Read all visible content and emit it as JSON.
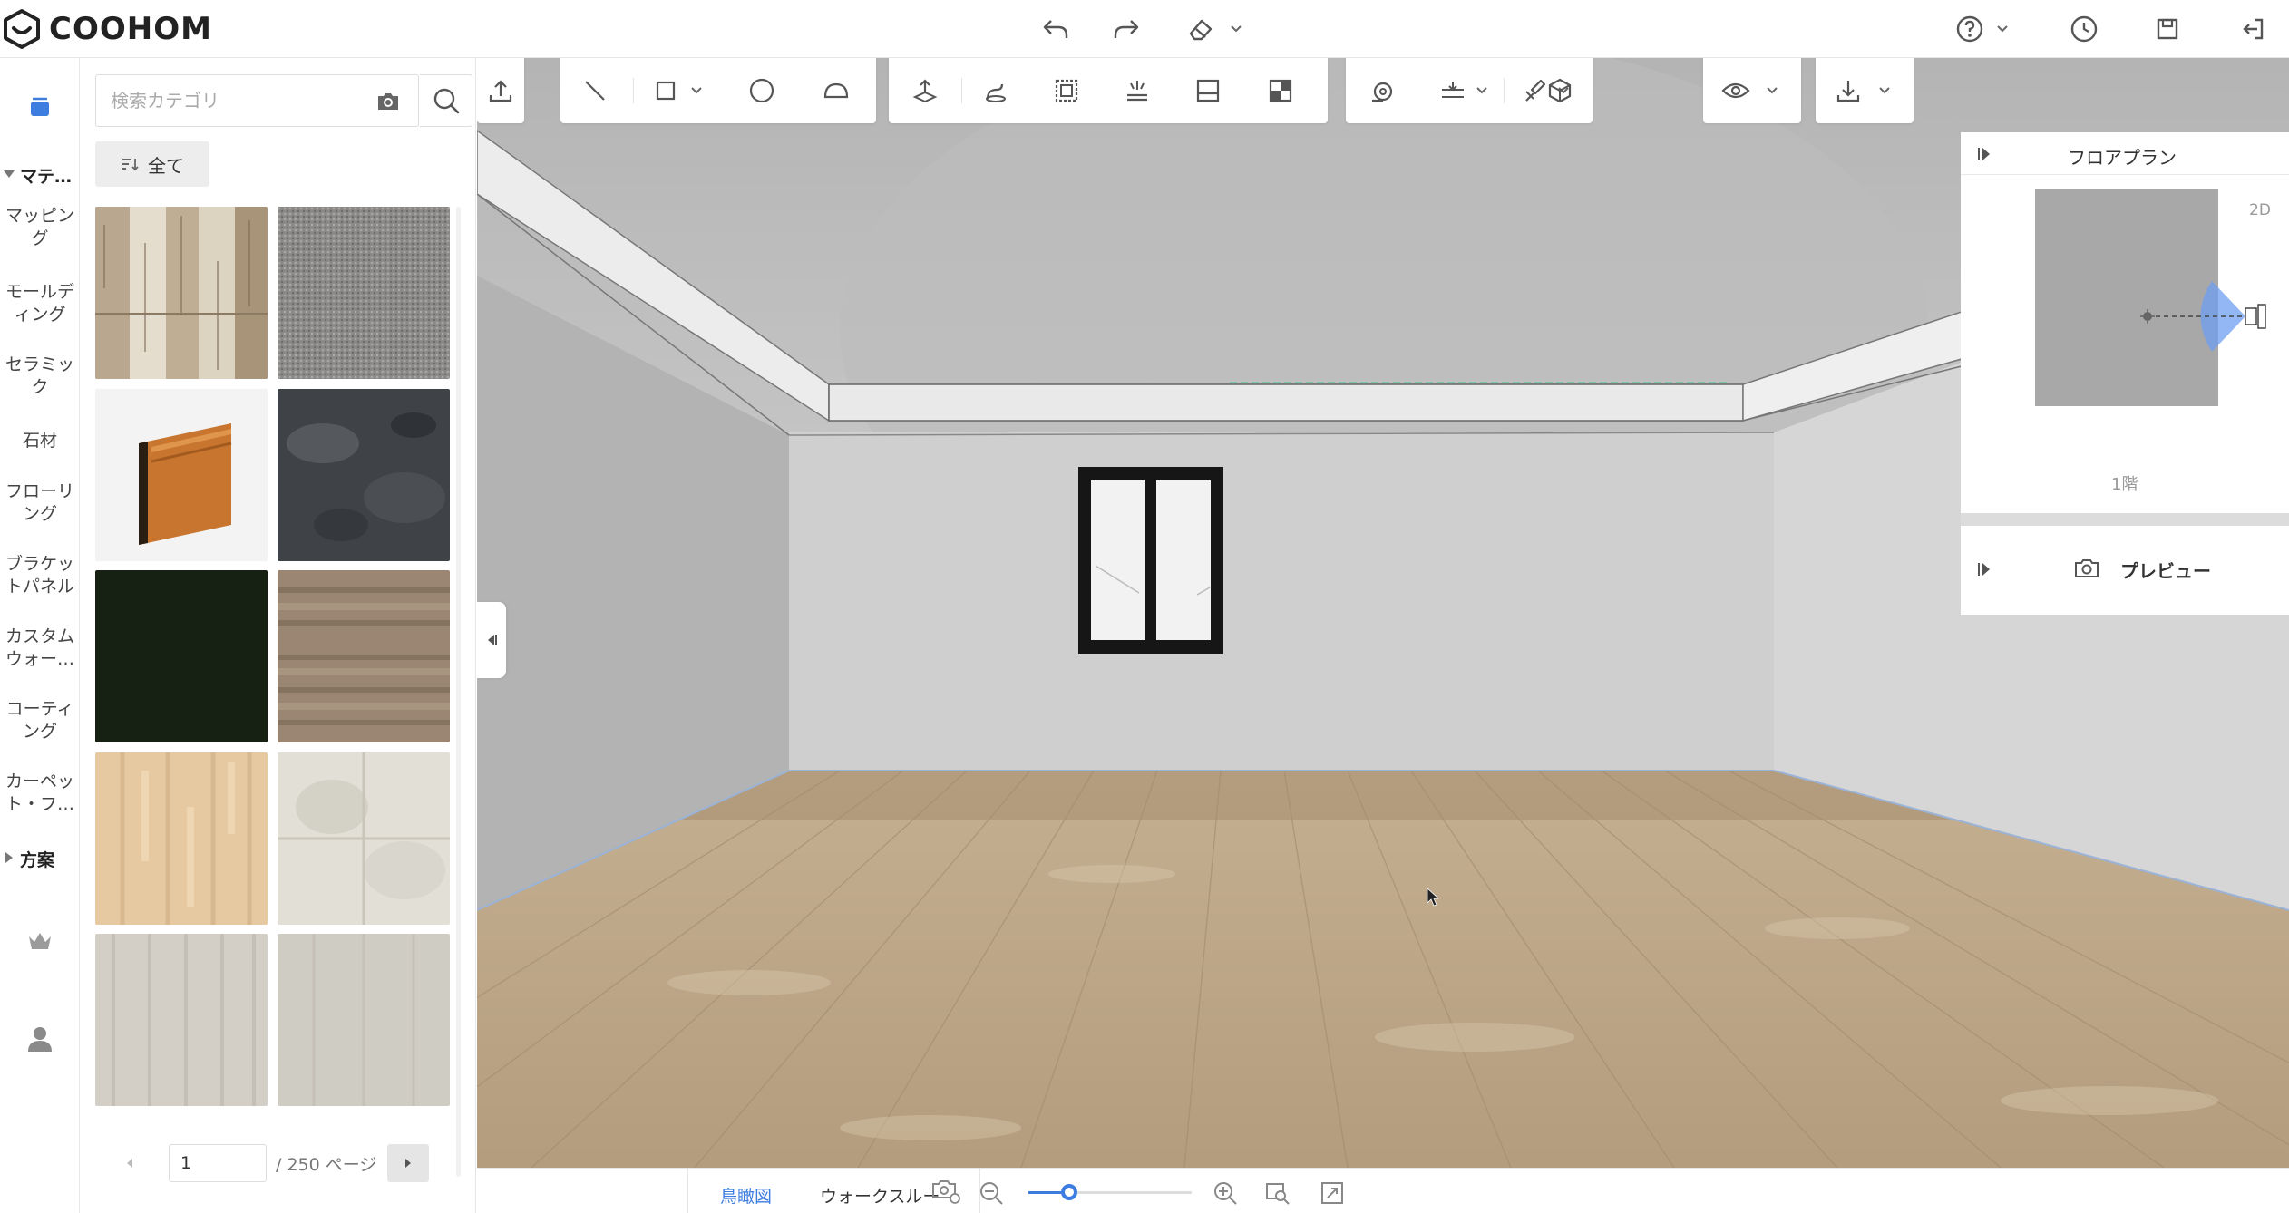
{
  "app": {
    "logo_text": "COOHOM"
  },
  "header": {
    "icons": [
      "undo-icon",
      "redo-icon",
      "eraser-icon",
      "help-icon",
      "history-icon",
      "save-icon",
      "exit-icon"
    ]
  },
  "rail": {
    "sections": [
      {
        "label": "マテ…",
        "expanded": true
      },
      {
        "label": "方案",
        "expanded": false
      }
    ],
    "items": [
      {
        "label": "マッピン\nグ"
      },
      {
        "label": "モールデ\nィング"
      },
      {
        "label": "セラミッ\nク"
      },
      {
        "label": "石材"
      },
      {
        "label": "フローリ\nング"
      },
      {
        "label": "ブラケッ\nトパネル"
      },
      {
        "label": "カスタム\nウォー…"
      },
      {
        "label": "コーティ\nング"
      },
      {
        "label": "カーペッ\nト・フ…"
      }
    ]
  },
  "catalog": {
    "search_placeholder": "検索カテゴリ",
    "all_label": "全て",
    "tiles": [
      {
        "name": "whitewashed-wood-texture"
      },
      {
        "name": "gray-carpet-texture"
      },
      {
        "name": "wood-skirting-board"
      },
      {
        "name": "dark-gray-stone-texture"
      },
      {
        "name": "dark-green-solid"
      },
      {
        "name": "distressed-wood-texture"
      },
      {
        "name": "light-oak-texture"
      },
      {
        "name": "white-marble-texture"
      },
      {
        "name": "pale-wood-texture"
      },
      {
        "name": "light-gray-wood-texture"
      }
    ],
    "pager": {
      "current": "1",
      "total_label": "/ 250 ページ"
    }
  },
  "floorplan": {
    "title": "フロアプラン",
    "mode_label": "2D",
    "floor_label": "1階"
  },
  "preview": {
    "label": "プレビュー"
  },
  "statusbar": {
    "view_tabs": [
      {
        "label": "鳥瞰図",
        "active": true
      },
      {
        "label": "ウォークスルー",
        "active": false
      }
    ],
    "zoom_level": 0.25
  },
  "colors": {
    "accent": "#3d7de0",
    "ceiling": "#bdbdbd",
    "wall": "#cfcfcf",
    "floor": "#b9a384"
  }
}
